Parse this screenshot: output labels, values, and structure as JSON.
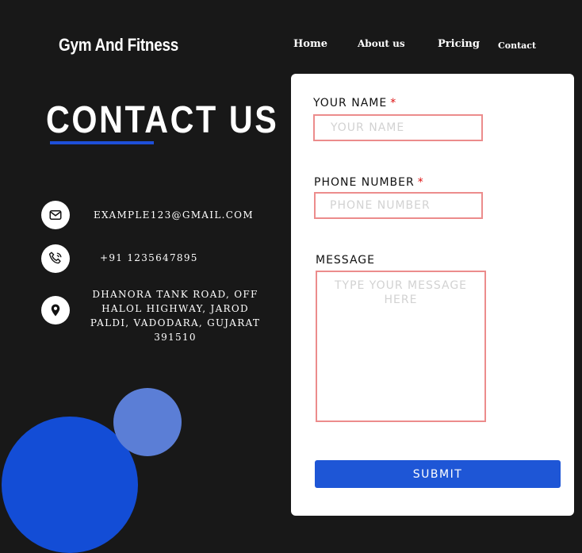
{
  "brand": "Gym And Fitness",
  "nav": {
    "home": "Home",
    "about": "About us",
    "pricing": "Pricing",
    "contact": "Contact"
  },
  "hero": {
    "title": "CONTACT US"
  },
  "info": {
    "email": "EXAMPLE123@GMAIL.COM",
    "phone": "+91 1235647895",
    "address": "DHANORA TANK ROAD, OFF HALOL HIGHWAY, JAROD PALDI, VADODARA, GUJARAT 391510",
    "icons": [
      "mail-icon",
      "phone-icon",
      "location-pin-icon"
    ]
  },
  "form": {
    "name_label": "YOUR NAME",
    "name_placeholder": "YOUR NAME",
    "phone_label": "PHONE NUMBER",
    "phone_placeholder": "PHONE NUMBER",
    "required_mark": "*",
    "message_label": "MESSAGE",
    "message_placeholder": "TYPE YOUR MESSAGE HERE",
    "submit_label": "SUBMIT"
  },
  "colors": {
    "background": "#181818",
    "accent": "#1e56d6",
    "circle_big": "#134dd6",
    "circle_small": "#5b7ed6",
    "field_border": "#ec8c8c",
    "required": "#dd1111"
  }
}
